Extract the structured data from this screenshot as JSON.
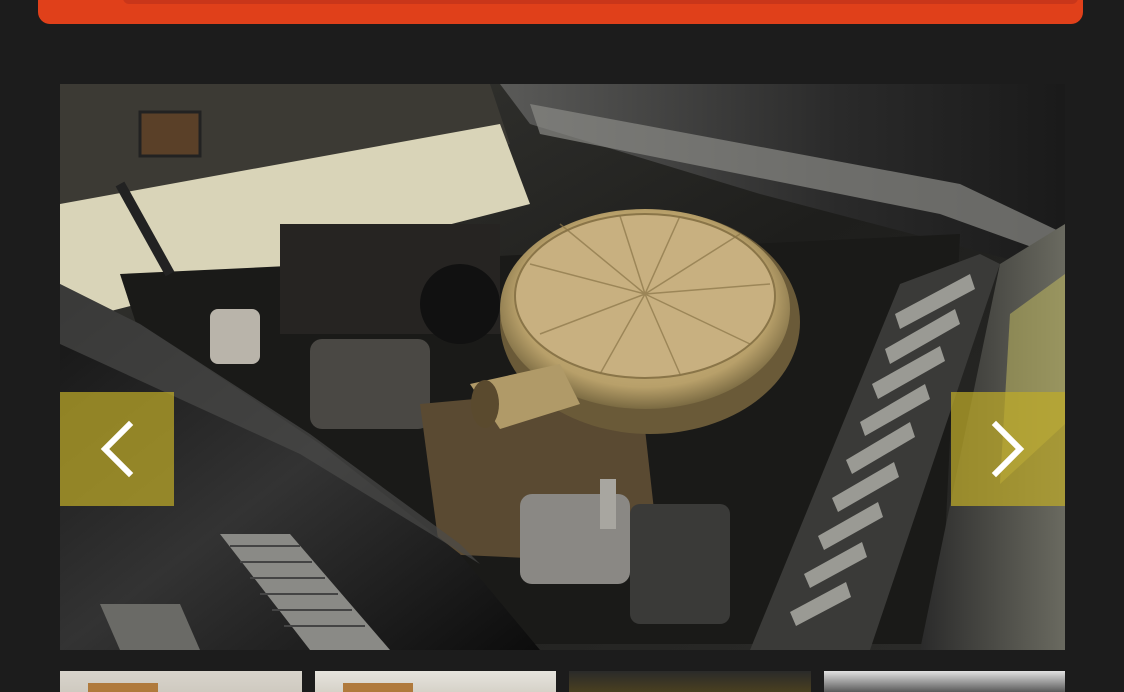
{
  "page": {
    "background": "#1c1c1c",
    "banner_color": "#e0401a"
  },
  "gallery": {
    "main_image_subject": "engine-bay-photo",
    "prev_icon": "chevron-left-icon",
    "next_icon": "chevron-right-icon",
    "nav_color": "#bea828",
    "thumbnails": [
      {
        "name": "thumbnail-1"
      },
      {
        "name": "thumbnail-2"
      },
      {
        "name": "thumbnail-3"
      },
      {
        "name": "thumbnail-4"
      }
    ]
  }
}
